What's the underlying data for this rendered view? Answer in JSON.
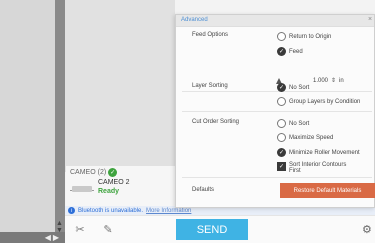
{
  "panel": {
    "title": "Advanced",
    "close_glyph": "×",
    "feed_options": {
      "label": "Feed Options",
      "options": [
        "Return to Origin",
        "Feed"
      ],
      "selected": "Feed",
      "feed_value": "1.000",
      "feed_unit": "in"
    },
    "layer_sorting": {
      "label": "Layer Sorting",
      "options": [
        "No Sort",
        "Group Layers by Condition"
      ],
      "selected": "No Sort"
    },
    "cut_order_sorting": {
      "label": "Cut Order Sorting",
      "options": [
        "No Sort",
        "Maximize Speed",
        "Minimize Roller Movement"
      ],
      "selected": "Minimize Roller Movement",
      "checkbox_label_line1": "Sort Interior Contours",
      "checkbox_label_line2": "First",
      "checkbox_checked": true
    },
    "defaults": {
      "label": "Defaults",
      "button_label": "Restore Default Materials"
    }
  },
  "device_list": {
    "header": "CAMEO (2)",
    "device_name": "CAMEO 2",
    "device_status": "Ready"
  },
  "bluetooth": {
    "message": "Bluetooth is unavailable.",
    "link": "More Information"
  },
  "bottom_bar": {
    "send_label": "SEND"
  },
  "icons": {
    "device_check": "check-icon",
    "info": "info-icon",
    "tool_left": "cut-tool-icon",
    "tool_right": "pen-tool-icon",
    "settings": "gear-icon"
  },
  "colors": {
    "send": "#3fb3e4",
    "restore": "#d96a45",
    "ready": "#3ea33e",
    "title": "#4d8fd4"
  }
}
